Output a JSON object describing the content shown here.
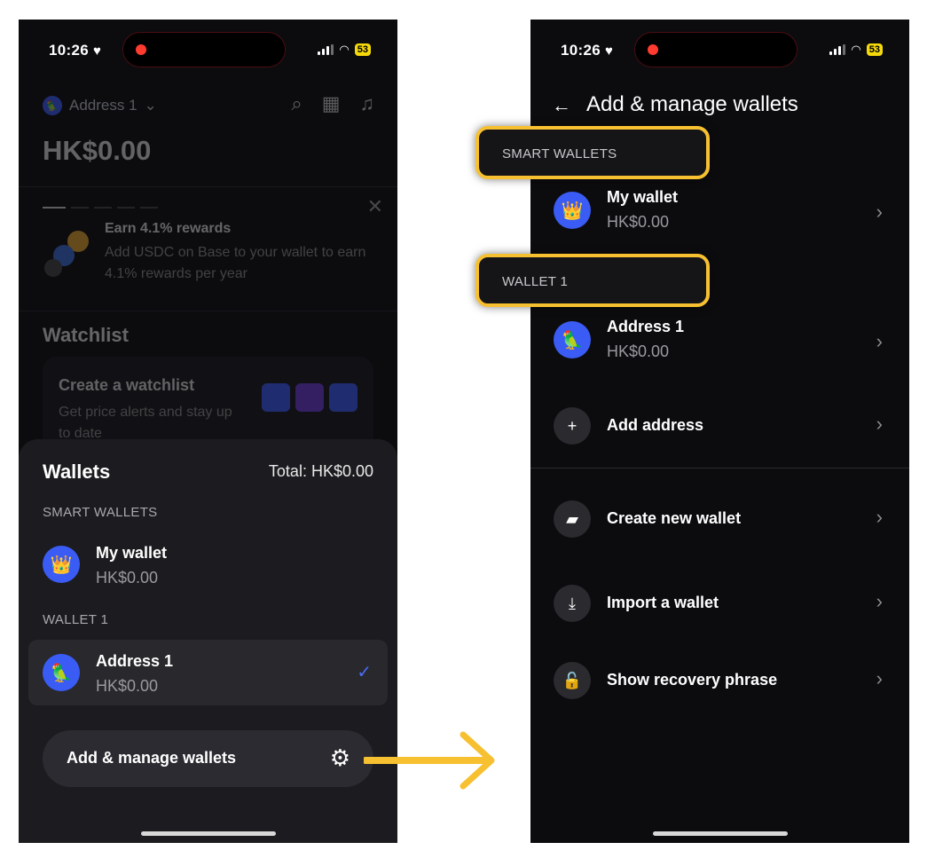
{
  "status": {
    "time": "10:26",
    "battery": "53"
  },
  "left": {
    "account_label": "Address 1",
    "balance": "HK$0.00",
    "promo": {
      "title": "Earn 4.1% rewards",
      "body": "Add USDC on Base to your wallet to earn 4.1% rewards per year"
    },
    "watchlist": {
      "title": "Watchlist",
      "card_title": "Create a watchlist",
      "card_body": "Get price alerts and stay up to date"
    },
    "sheet": {
      "title": "Wallets",
      "total": "Total: HK$0.00",
      "sections": [
        {
          "label": "SMART WALLETS",
          "wallets": [
            {
              "name": "My wallet",
              "balance": "HK$0.00"
            }
          ]
        },
        {
          "label": "WALLET 1",
          "wallets": [
            {
              "name": "Address 1",
              "balance": "HK$0.00",
              "selected": true
            }
          ]
        }
      ],
      "manage_label": "Add & manage wallets"
    }
  },
  "right": {
    "title": "Add & manage wallets",
    "sections": [
      {
        "label": "SMART WALLETS",
        "wallet": {
          "name": "My wallet",
          "balance": "HK$0.00"
        }
      },
      {
        "label": "WALLET 1",
        "wallet": {
          "name": "Address 1",
          "balance": "HK$0.00"
        }
      }
    ],
    "add_address": "Add address",
    "actions": [
      "Create new wallet",
      "Import a wallet",
      "Show recovery phrase"
    ]
  },
  "colors": {
    "highlight": "#f7c031",
    "accent": "#3a5cf5",
    "check": "#4a6cf5"
  }
}
